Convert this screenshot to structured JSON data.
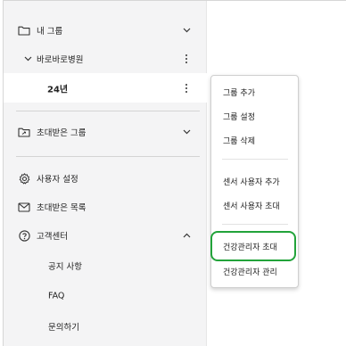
{
  "sidebar": {
    "my_groups": {
      "label": "내 그룹",
      "icon": "folder-icon",
      "right": "chevron-down-icon"
    },
    "hospital": {
      "label": "바로바로병원",
      "left": "chevron-down-icon",
      "right": "kebab-icon"
    },
    "year_group": {
      "label": "24년",
      "right": "kebab-icon"
    },
    "invited_groups": {
      "label": "초대받은 그룹",
      "icon": "shared-folder-icon",
      "right": "chevron-down-icon"
    },
    "user_settings": {
      "label": "사용자 설정",
      "icon": "gear-icon"
    },
    "invited_list": {
      "label": "초대받은 목록",
      "icon": "mail-icon"
    },
    "support": {
      "label": "고객센터",
      "icon": "help-circle-icon",
      "right": "chevron-up-icon"
    },
    "notice": {
      "label": "공지 사항"
    },
    "faq": {
      "label": "FAQ"
    },
    "inquiry": {
      "label": "문의하기"
    }
  },
  "context_menu": {
    "items": [
      "그룹 추가",
      "그룹 설정",
      "그룹 삭제",
      "센서 사용자 추가",
      "센서 사용자 초대",
      "건강관리자 초대",
      "건강관리자 관리"
    ],
    "highlighted_index": 5
  },
  "colors": {
    "highlight": "#22a33a",
    "sidebar_bg": "#f4f4f5"
  }
}
